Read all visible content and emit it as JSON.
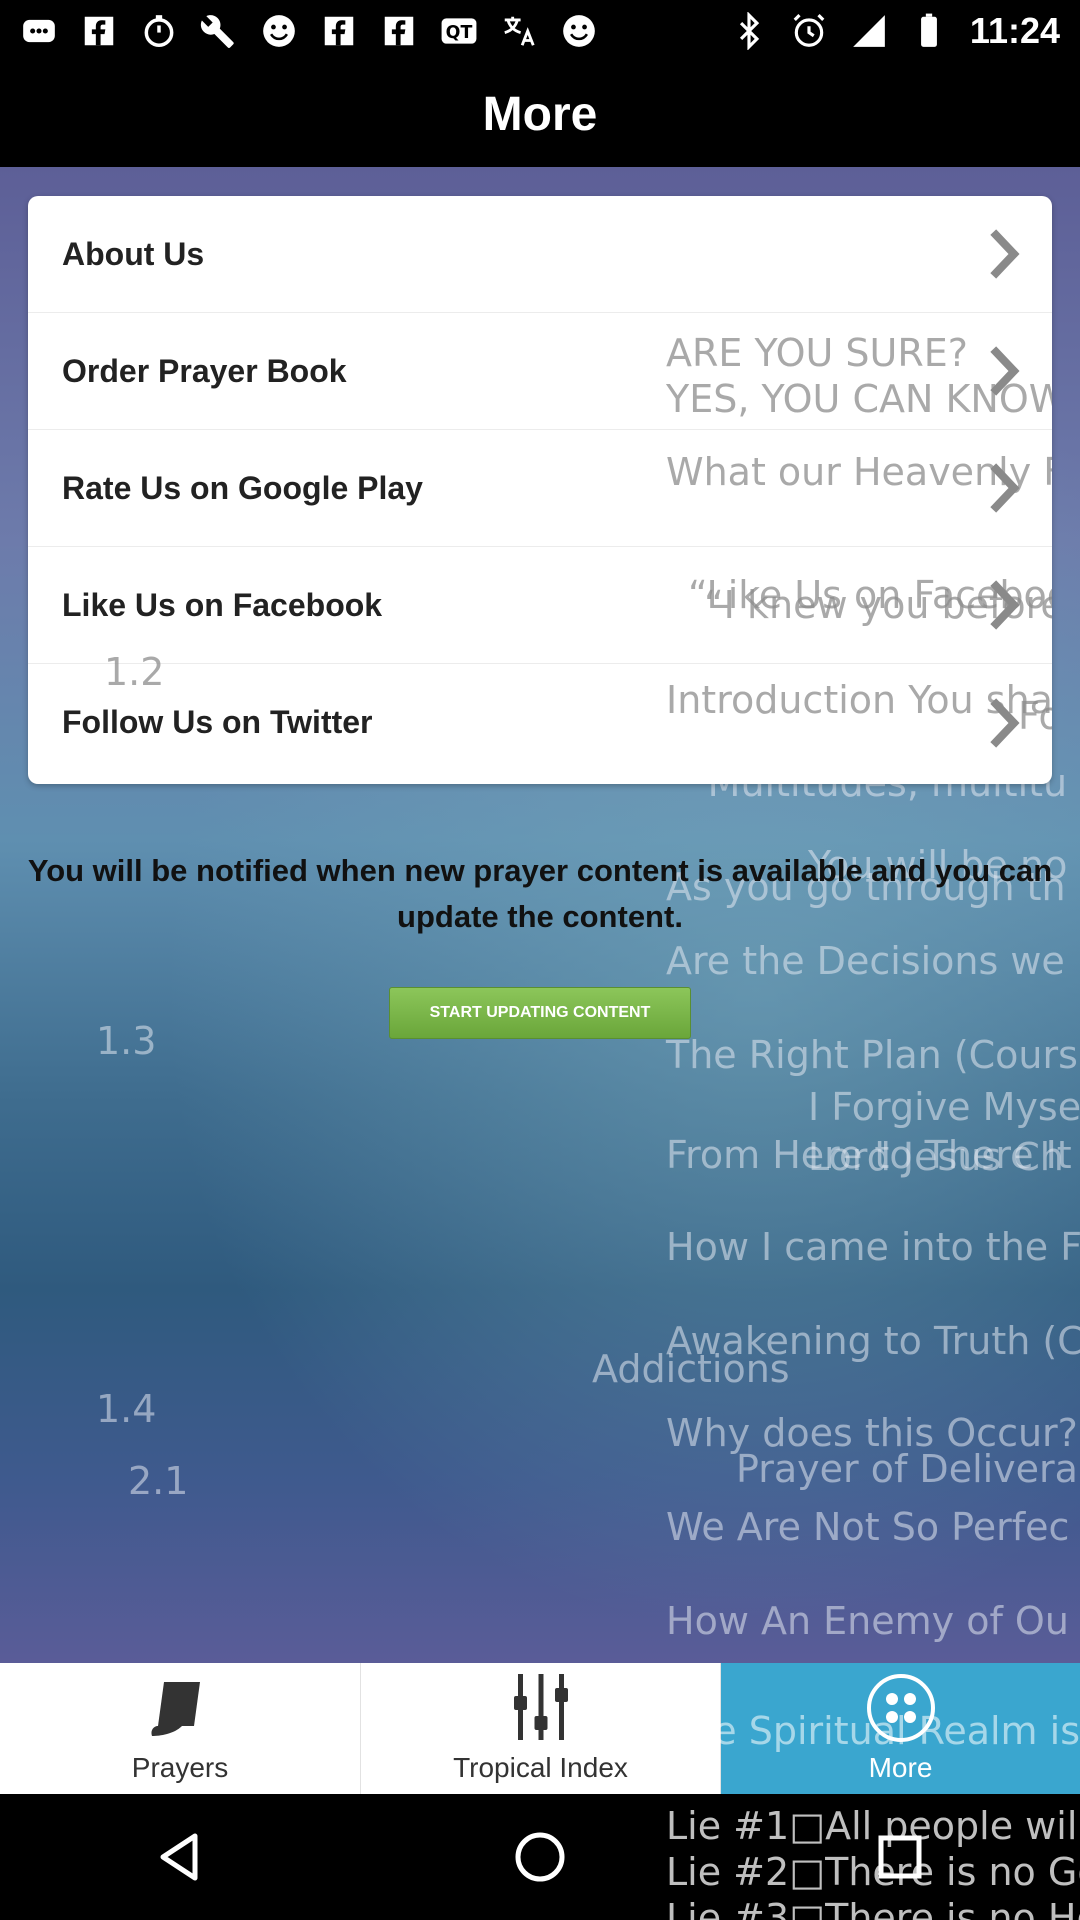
{
  "status_bar": {
    "time": "11:24",
    "left_icons": [
      "chat-icon",
      "facebook-icon",
      "stopwatch-icon",
      "wrench-icon",
      "smiley-icon",
      "facebook-icon",
      "facebook-icon",
      "qt-icon",
      "translate-icon",
      "smiley-icon"
    ],
    "right_icons": [
      "bluetooth-icon",
      "alarm-icon",
      "signal-icon",
      "battery-icon"
    ]
  },
  "header": {
    "title": "More"
  },
  "menu": {
    "items": [
      {
        "label": "About Us"
      },
      {
        "label": "Order Prayer Book"
      },
      {
        "label": "Rate Us on Google Play"
      },
      {
        "label": "Like Us on Facebook"
      },
      {
        "label": "Follow Us on Twitter"
      }
    ]
  },
  "notice": {
    "text": "You will be notified when new prayer content is available and you can update the content.",
    "button_label": "START UPDATING CONTENT"
  },
  "background_text": {
    "menu_overlap": [
      "ARE YOU SURE?",
      "YES, YOU CAN KNOW",
      "What our Heavenly Fa",
      "“I knew you before I",
      "“Like Us on Faceboo",
      "1.2",
      "Introduction You shal",
      "Fol"
    ],
    "lines": [
      "“Multitudes, multitu",
      "You will be no",
      "As you go through th",
      "Are the Decisions we",
      "1.3",
      "The Right Plan (Cours",
      "I Forgive Myse",
      "Lord Jesus Ch",
      "From Here to There It",
      "How I came into the F",
      "Awakening to Truth (C",
      "Addictions",
      "1.4",
      "Why does this Occur?",
      "2.1",
      "Prayer of Deliveran",
      "We Are Not So Perfec",
      "How An Enemy of Ou",
      "The Spiritual Realm is"
    ],
    "nav_overlap": [
      "Lie #1□All people will",
      "Lie #2□There is no Go",
      "Lie #3□There is no Ho"
    ]
  },
  "tabs": [
    {
      "label": "Prayers",
      "icon": "book-icon",
      "active": false
    },
    {
      "label": "Tropical Index",
      "icon": "sliders-icon",
      "active": false
    },
    {
      "label": "More",
      "icon": "dots-icon",
      "active": true
    }
  ],
  "nav": {
    "buttons": [
      "back-icon",
      "home-icon",
      "recents-icon"
    ]
  },
  "colors": {
    "active_tab": "#3aa6cf",
    "button_green": "#7ab84a",
    "header_bg": "#000000"
  }
}
